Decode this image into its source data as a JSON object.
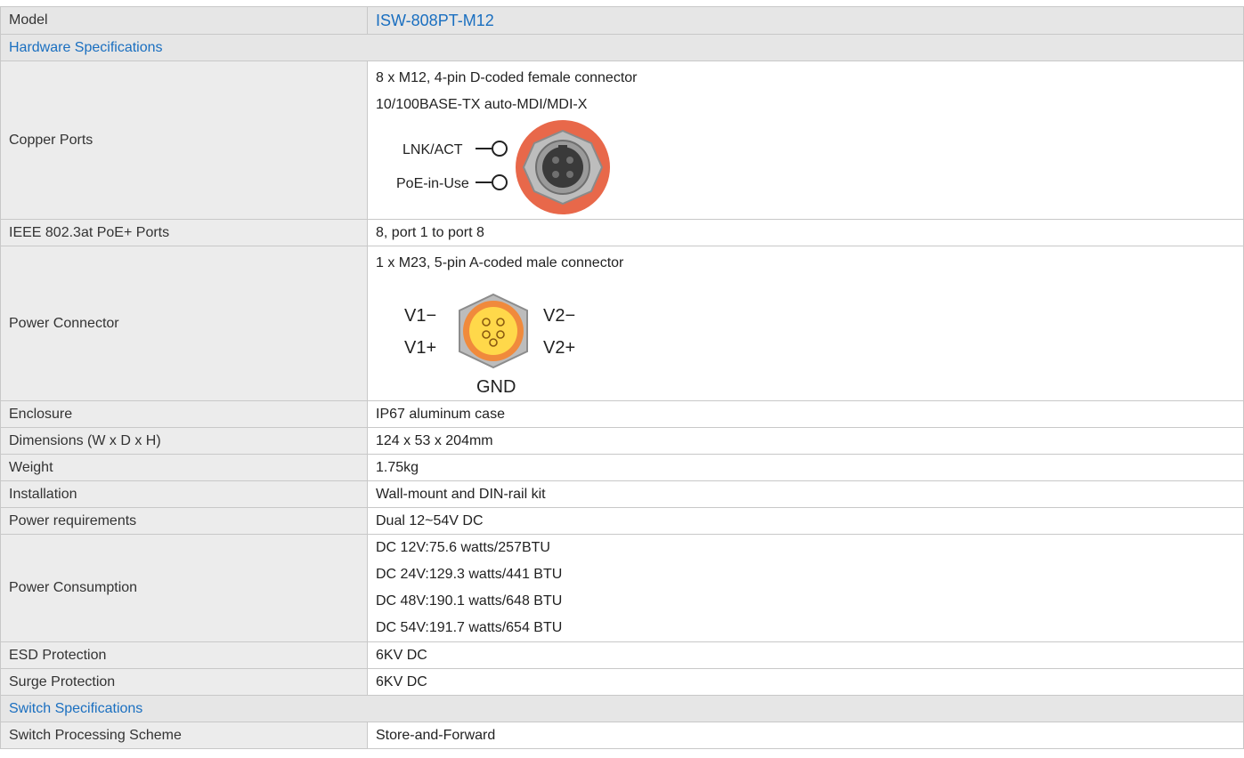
{
  "model": {
    "label": "Model",
    "value": "ISW-808PT-M12"
  },
  "sections": {
    "hardware": "Hardware Specifications",
    "switch": "Switch Specifications"
  },
  "copper_ports": {
    "label": "Copper Ports",
    "lines": [
      "8 x M12, 4-pin D-coded female connector",
      "10/100BASE-TX auto-MDI/MDI-X"
    ],
    "led_labels": [
      "LNK/ACT",
      "PoE-in-Use"
    ],
    "colors": {
      "ring": "#e8684a",
      "body": "#b4b4b4",
      "face": "#3a3a3a"
    }
  },
  "poe_ports": {
    "label": "IEEE 802.3at PoE+ Ports",
    "value": "8, port 1 to port 8"
  },
  "power_connector": {
    "label": "Power Connector",
    "line": "1 x M23, 5-pin A-coded male connector",
    "pins": {
      "v1_minus": "V1−",
      "v1_plus": "V1+",
      "v2_minus": "V2−",
      "v2_plus": "V2+",
      "gnd": "GND"
    },
    "colors": {
      "hex": "#b9b9b9",
      "face_outer": "#f08a3c",
      "face_inner": "#ffd84a"
    }
  },
  "enclosure": {
    "label": "Enclosure",
    "value": "IP67 aluminum case"
  },
  "dimensions": {
    "label": "Dimensions (W x D x H)",
    "value": "124 x 53 x 204mm"
  },
  "weight": {
    "label": "Weight",
    "value": "1.75kg"
  },
  "installation": {
    "label": "Installation",
    "value": "Wall-mount and DIN-rail kit"
  },
  "power_requirements": {
    "label": "Power requirements",
    "value": "Dual 12~54V DC"
  },
  "power_consumption": {
    "label": "Power Consumption",
    "lines": [
      "DC 12V:75.6 watts/257BTU",
      "DC 24V:129.3 watts/441 BTU",
      "DC 48V:190.1 watts/648 BTU",
      "DC 54V:191.7 watts/654 BTU"
    ]
  },
  "esd": {
    "label": "ESD Protection",
    "value": "6KV DC"
  },
  "surge": {
    "label": "Surge Protection",
    "value": "6KV DC"
  },
  "processing": {
    "label": "Switch Processing Scheme",
    "value": "Store-and-Forward"
  },
  "accent_color": "#1a6fc0"
}
